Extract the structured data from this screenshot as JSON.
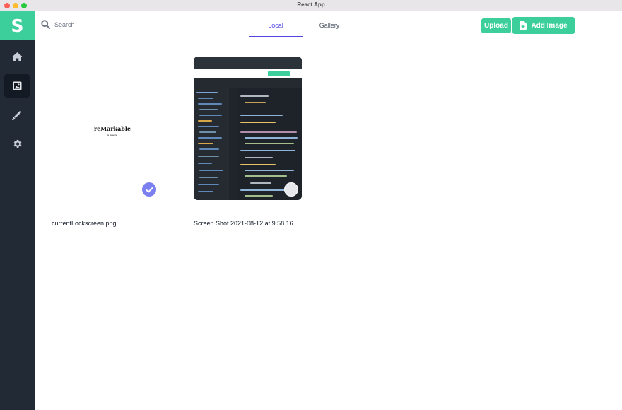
{
  "window": {
    "title": "React App"
  },
  "sidebar": {
    "logo": "S",
    "items": [
      {
        "name": "home",
        "icon": "home-icon"
      },
      {
        "name": "images",
        "icon": "image-icon",
        "active": true
      },
      {
        "name": "draw",
        "icon": "pen-icon"
      },
      {
        "name": "settings",
        "icon": "gear-icon"
      }
    ]
  },
  "search": {
    "label": "Search",
    "icon": "search-icon"
  },
  "tabs": [
    {
      "label": "Local",
      "active": true
    },
    {
      "label": "Gallery",
      "active": false
    }
  ],
  "toolbar": {
    "upload_label": "Upload",
    "add_image_label": "Add Image",
    "add_image_icon": "file-plus-icon"
  },
  "images": [
    {
      "caption": "currentLockscreen.png",
      "selected": true,
      "thumb_brand": "reMarkable",
      "thumb_sub": "is sleeping"
    },
    {
      "caption": "Screen Shot 2021-08-12 at 9.58.16 ...",
      "selected": false
    }
  ],
  "colors": {
    "accent": "#3ccf9c",
    "sidebar": "#222a36",
    "tab_active": "#4f46e5",
    "check": "#7c7ff0"
  }
}
